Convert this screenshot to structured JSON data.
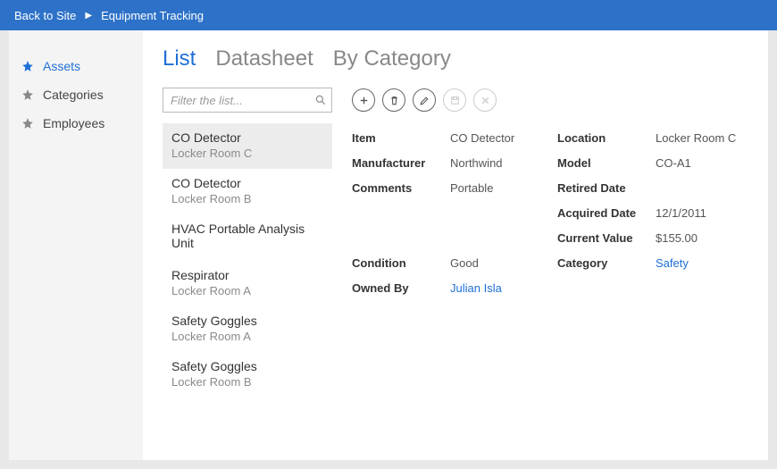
{
  "topbar": {
    "back": "Back to Site",
    "title": "Equipment Tracking"
  },
  "sidebar": {
    "items": [
      {
        "label": "Assets",
        "active": true
      },
      {
        "label": "Categories",
        "active": false
      },
      {
        "label": "Employees",
        "active": false
      }
    ]
  },
  "tabs": [
    {
      "label": "List",
      "active": true
    },
    {
      "label": "Datasheet",
      "active": false
    },
    {
      "label": "By Category",
      "active": false
    }
  ],
  "filter": {
    "placeholder": "Filter the list..."
  },
  "list": [
    {
      "title": "CO Detector",
      "sub": "Locker Room C",
      "selected": true
    },
    {
      "title": "CO Detector",
      "sub": "Locker Room B"
    },
    {
      "title": "HVAC Portable Analysis Unit",
      "sub": ""
    },
    {
      "title": "Respirator",
      "sub": "Locker Room A"
    },
    {
      "title": "Safety Goggles",
      "sub": "Locker Room A"
    },
    {
      "title": "Safety Goggles",
      "sub": "Locker Room B"
    }
  ],
  "toolbar": {
    "add": "add",
    "delete": "delete",
    "edit": "edit",
    "save": "save",
    "cancel": "cancel"
  },
  "detail": {
    "labels": {
      "item": "Item",
      "manufacturer": "Manufacturer",
      "comments": "Comments",
      "condition": "Condition",
      "owned_by": "Owned By",
      "location": "Location",
      "model": "Model",
      "retired_date": "Retired Date",
      "acquired_date": "Acquired Date",
      "current_value": "Current Value",
      "category": "Category"
    },
    "values": {
      "item": "CO Detector",
      "manufacturer": "Northwind",
      "comments": "Portable",
      "condition": "Good",
      "owned_by": "Julian Isla",
      "location": "Locker Room C",
      "model": "CO-A1",
      "retired_date": "",
      "acquired_date": "12/1/2011",
      "current_value": "$155.00",
      "category": "Safety"
    }
  }
}
